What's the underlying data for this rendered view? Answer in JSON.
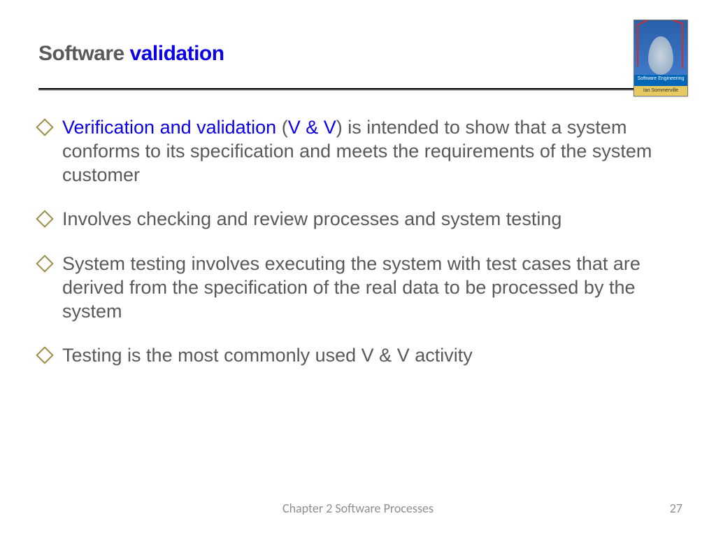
{
  "title": {
    "part1": "Software ",
    "part2": "validation"
  },
  "book": {
    "line1": "Software Engineering",
    "author": "Ian Sommerville"
  },
  "bullets": [
    {
      "segments": [
        {
          "text": "Verification and validation",
          "blue": true
        },
        {
          "text": " (",
          "blue": false
        },
        {
          "text": "V & V",
          "blue": true
        },
        {
          "text": ") is intended to show that a system conforms to its specification and meets the requirements of the system customer",
          "blue": false
        }
      ]
    },
    {
      "segments": [
        {
          "text": "Involves checking and review processes and system testing",
          "blue": false
        }
      ]
    },
    {
      "segments": [
        {
          "text": "System testing involves executing the system with test cases that are derived from the specification of the real data to be processed by the system",
          "blue": false
        }
      ]
    },
    {
      "segments": [
        {
          "text": "Testing is the most commonly used V & V activity",
          "blue": false
        }
      ]
    }
  ],
  "footer": {
    "chapter": "Chapter 2 Software Processes",
    "page": "27"
  }
}
